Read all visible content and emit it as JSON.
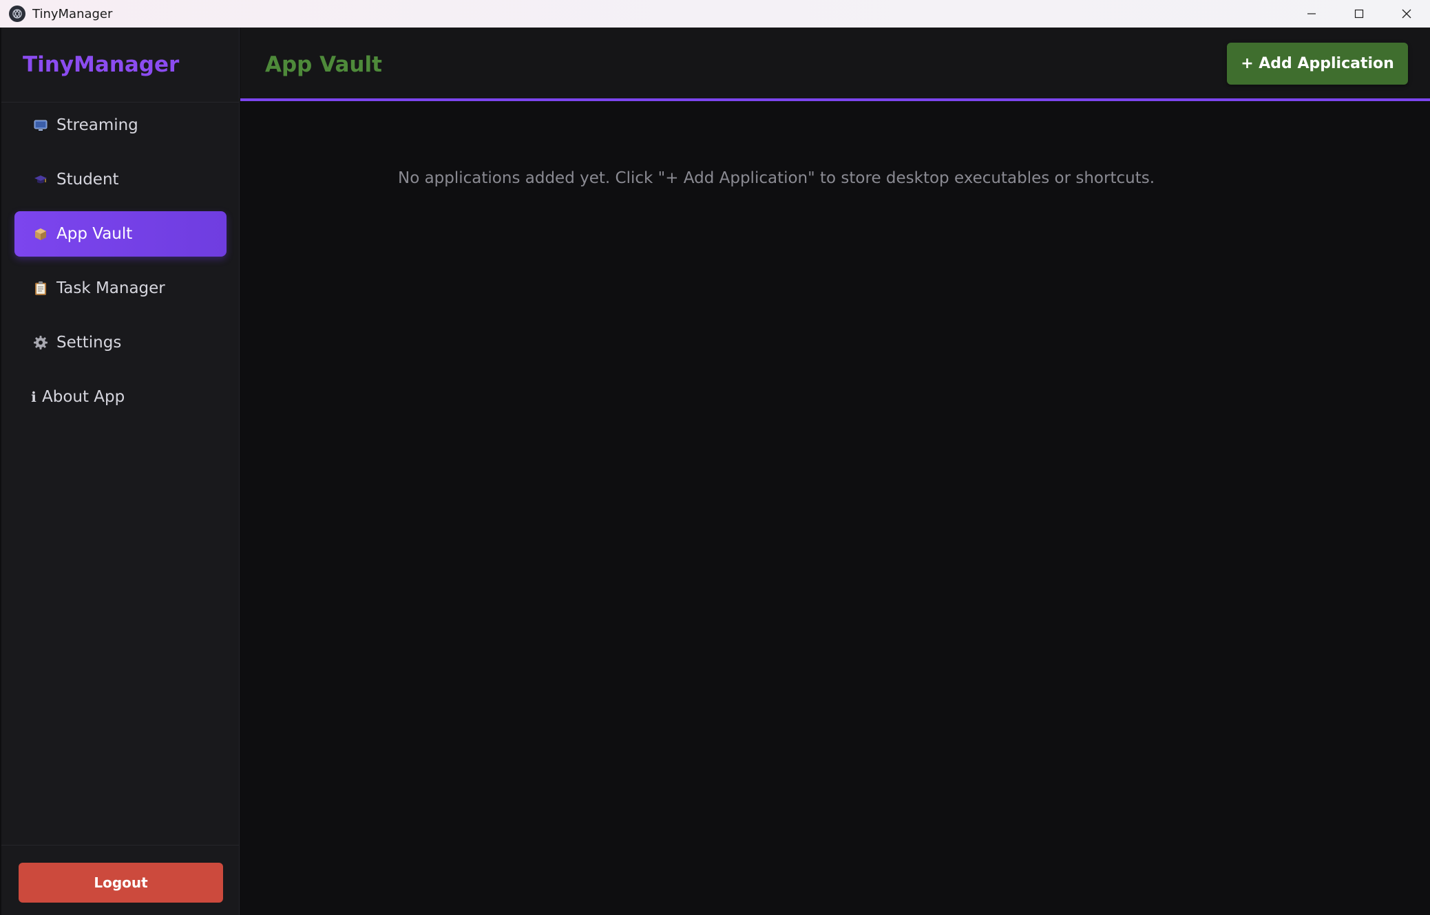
{
  "window": {
    "title": "TinyManager"
  },
  "sidebar": {
    "brand": "TinyManager",
    "items": [
      {
        "label": "Streaming",
        "icon": "tv-icon"
      },
      {
        "label": "Student",
        "icon": "graduation-cap-icon"
      },
      {
        "label": "App Vault",
        "icon": "package-icon",
        "active": true
      },
      {
        "label": "Task Manager",
        "icon": "clipboard-icon"
      },
      {
        "label": "Settings",
        "icon": "gear-icon"
      },
      {
        "label": "About App",
        "icon": "info-icon"
      }
    ],
    "logout_label": "Logout"
  },
  "header": {
    "title": "App Vault",
    "add_button_label": "+ Add Application"
  },
  "main": {
    "empty_message": "No applications added yet. Click \"+ Add Application\" to store desktop executables or shortcuts."
  },
  "colors": {
    "accent": "#7c45ee",
    "brand": "#8b4cf0",
    "title_green": "#4e8a3a",
    "add_button": "#3f6e2e",
    "logout": "#cc4a3d"
  }
}
